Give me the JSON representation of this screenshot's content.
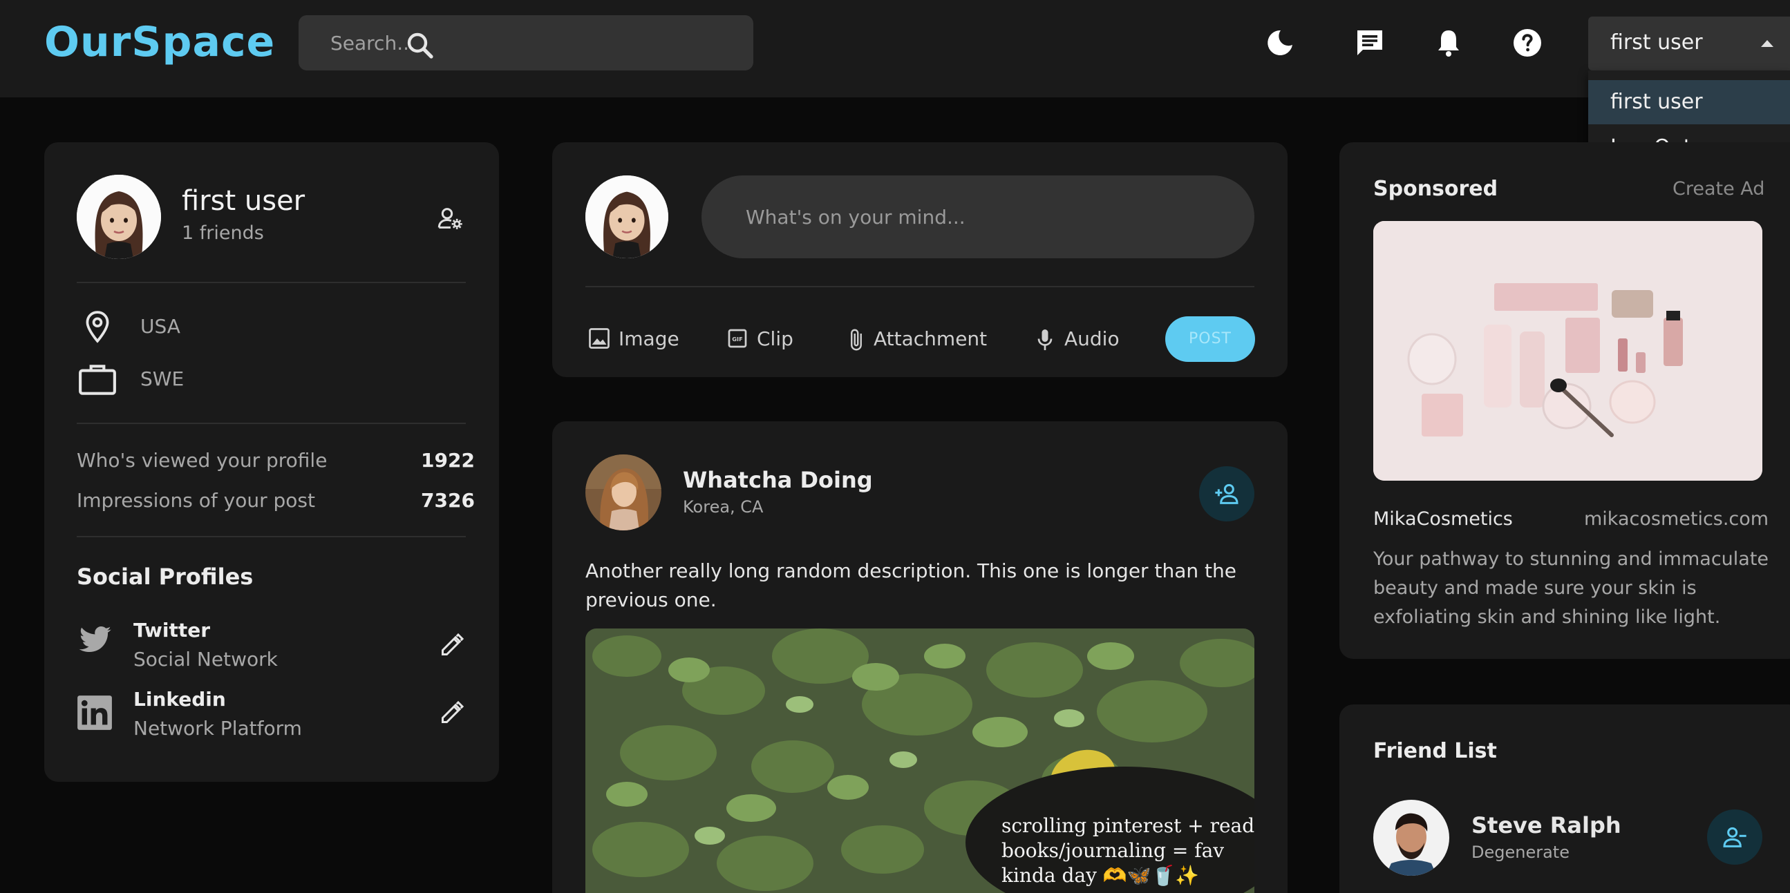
{
  "app": {
    "logo": "OurSpace"
  },
  "search": {
    "placeholder": "Search..."
  },
  "user_menu": {
    "selected": "first user",
    "options": [
      "first user",
      "Log Out"
    ]
  },
  "profile": {
    "name": "first user",
    "friends": "1 friends",
    "location": "USA",
    "occupation": "SWE",
    "stats": [
      {
        "label": "Who's viewed your profile",
        "value": "1922"
      },
      {
        "label": "Impressions of your post",
        "value": "7326"
      }
    ],
    "social_title": "Social Profiles",
    "socials": [
      {
        "name": "Twitter",
        "type": "Social Network"
      },
      {
        "name": "Linkedin",
        "type": "Network Platform"
      }
    ]
  },
  "composer": {
    "placeholder": "What's on your mind...",
    "actions": [
      "Image",
      "Clip",
      "Attachment",
      "Audio"
    ],
    "post_label": "POST"
  },
  "post": {
    "author": "Whatcha Doing",
    "location": "Korea, CA",
    "description": "Another really long random description. This one is longer than the previous one.",
    "image_caption": [
      "scrolling pinterest + reading",
      "books/journaling = fav",
      "kinda day  🫶🦋🥤✨"
    ]
  },
  "sponsored": {
    "title": "Sponsored",
    "create_ad": "Create Ad",
    "brand": "MikaCosmetics",
    "url": "mikacosmetics.com",
    "description_lines": [
      "Your pathway to stunning and immaculate",
      "beauty and made sure your skin is",
      "exfoliating skin and shining like light."
    ]
  },
  "friend_list": {
    "title": "Friend List",
    "friends": [
      {
        "name": "Steve Ralph",
        "subtitle": "Degenerate"
      }
    ]
  },
  "colors": {
    "accent": "#5ecbf1",
    "card": "#1a1a1a",
    "background": "#0a0a0a"
  }
}
